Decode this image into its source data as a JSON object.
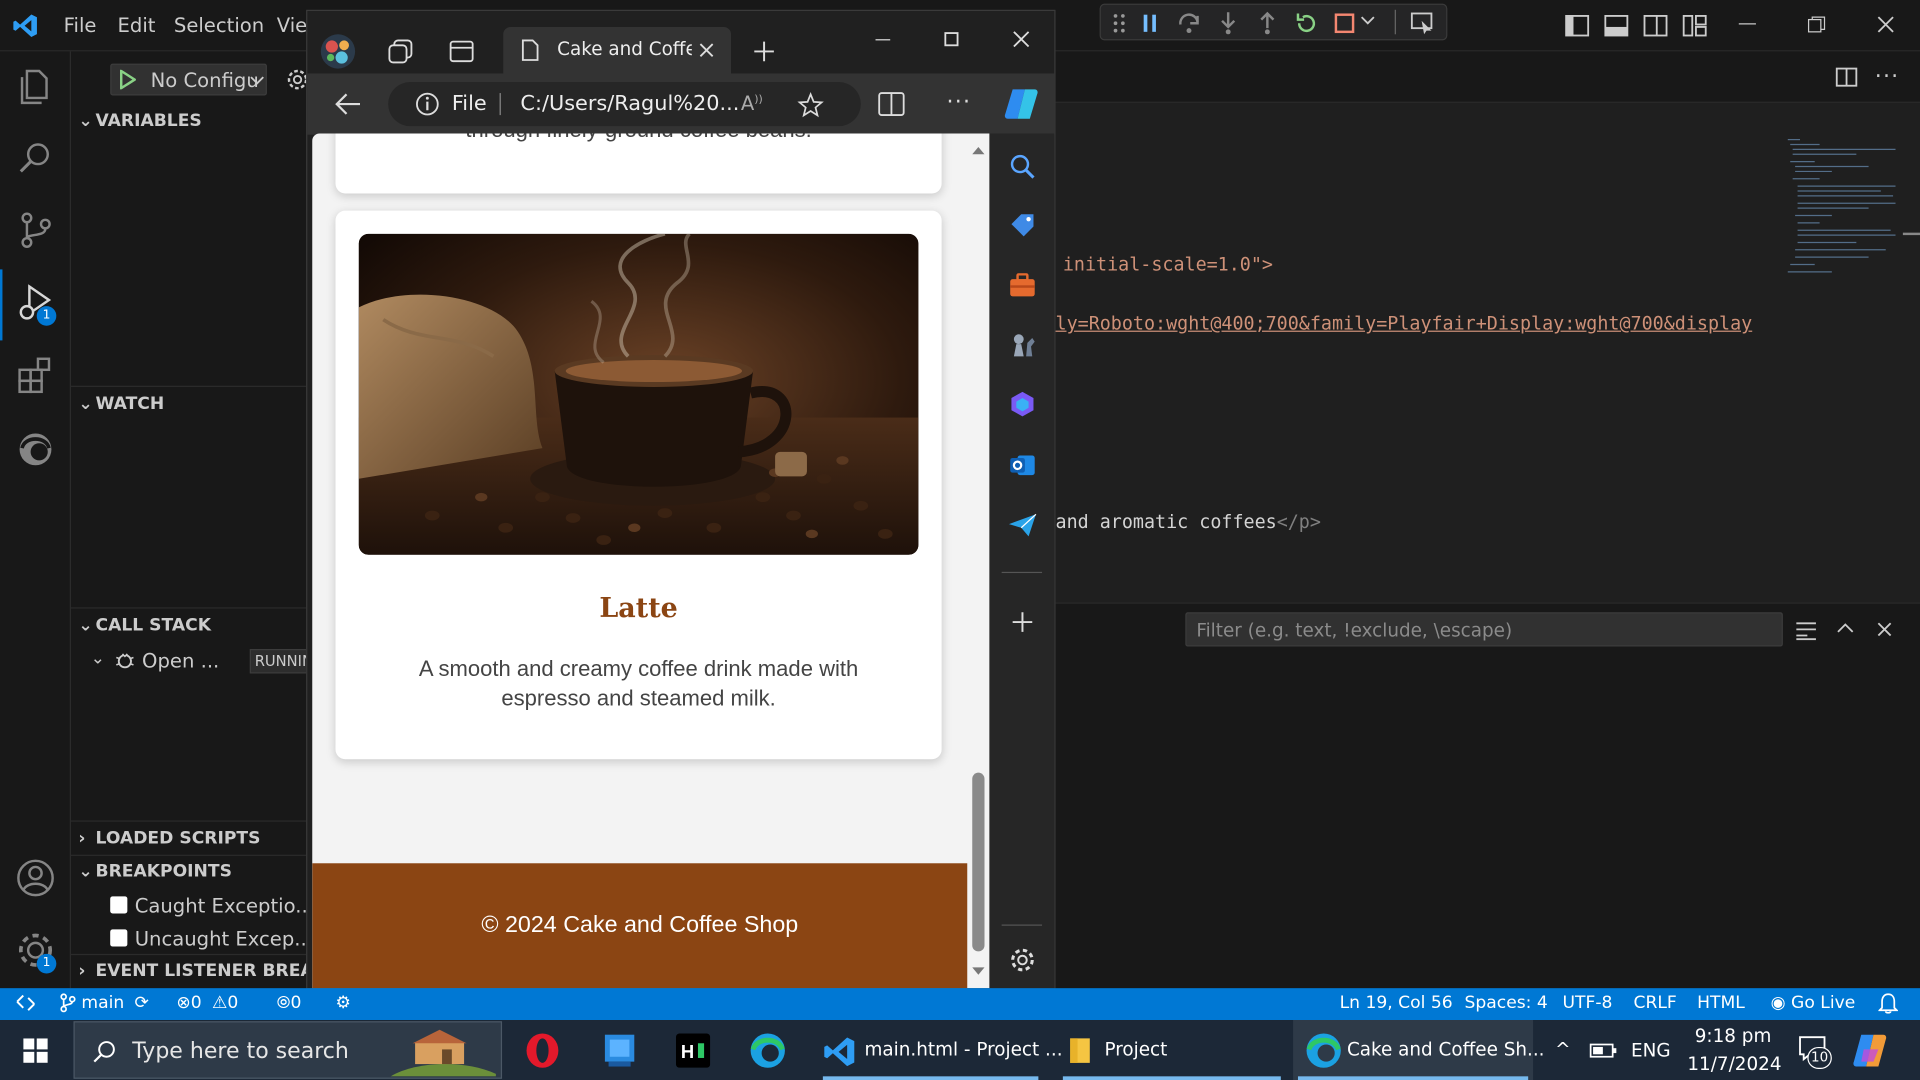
{
  "menu": {
    "file": "File",
    "edit": "Edit",
    "selection": "Selection",
    "view_trunc": "Vie"
  },
  "debug_sidebar": {
    "run_config": "No Configu",
    "variables": "VARIABLES",
    "watch": "WATCH",
    "call_stack": "CALL STACK",
    "call_stack_item": "Open ...",
    "running_badge": "RUNNING",
    "loaded_scripts": "LOADED SCRIPTS",
    "breakpoints": "BREAKPOINTS",
    "bp_caught": "Caught Exceptio...",
    "bp_uncaught": "Uncaught Excep...",
    "event_listener": "EVENT LISTENER BREAKP..."
  },
  "activity_badges": {
    "run_debug": "1",
    "manage": "1"
  },
  "editor": {
    "line1_text": " initial-scale=1.0\">",
    "line2_text": "ly=Roboto:wght@400;700&family=Playfair+Display:wght@700&display",
    "line3_text": "and aromatic coffees",
    "line3_tag": "</p>"
  },
  "panel": {
    "filter_placeholder": "Filter (e.g. text, !exclude, \\escape)"
  },
  "browser": {
    "tab_title": "Cake and Coffee",
    "address_label": "File",
    "address_url": "C:/Users/Ragul%20...",
    "page": {
      "prev_card_text": "through finely-ground coffee beans.",
      "card_title": "Latte",
      "card_desc": "A smooth and creamy coffee drink made with espresso and steamed milk.",
      "footer": "© 2024 Cake and Coffee Shop"
    }
  },
  "status": {
    "branch": "main",
    "errors": "0",
    "warnings": "0",
    "ports": "0",
    "position": "Ln 19, Col 56",
    "spaces": "Spaces: 4",
    "encoding": "UTF-8",
    "eol": "CRLF",
    "language": "HTML",
    "go_live": "Go Live"
  },
  "taskbar": {
    "search_placeholder": "Type here to search",
    "vscode_label": "main.html - Project ...",
    "explorer_label": "Project",
    "edge_label": "Cake and Coffee Sh...",
    "language": "ENG",
    "time": "9:18 pm",
    "date": "11/7/2024",
    "notifications": "10"
  },
  "colors": {
    "accent": "#0078d4",
    "footer_brown": "#8b4513",
    "card_title_brown": "#8b4513"
  }
}
